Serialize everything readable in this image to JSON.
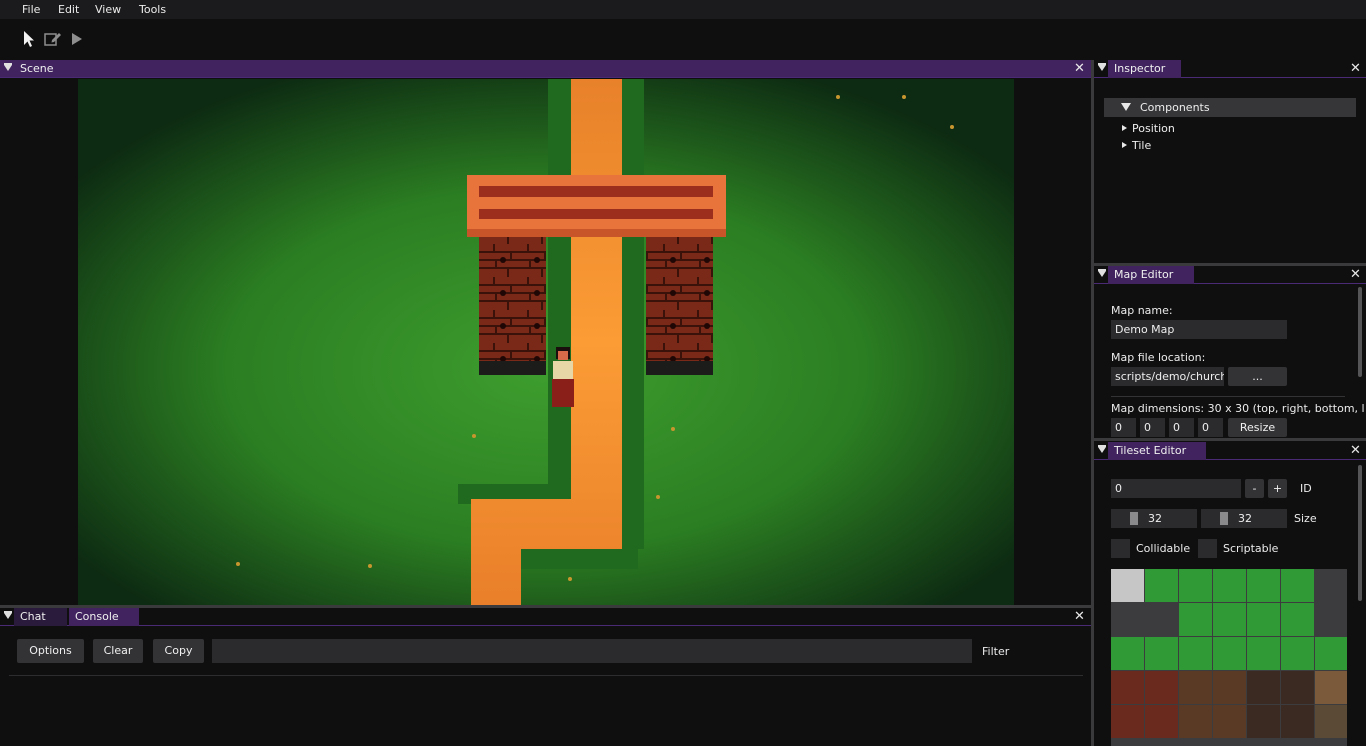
{
  "menu": {
    "file": "File",
    "edit": "Edit",
    "view": "View",
    "tools": "Tools"
  },
  "toolbar": {
    "select_icon": "cursor-icon",
    "edit_icon": "edit-icon",
    "play_icon": "play-icon"
  },
  "scene": {
    "tab": "Scene",
    "close": "✕"
  },
  "inspector": {
    "tab": "Inspector",
    "close": "✕",
    "components_label": "Components",
    "items": [
      "Position",
      "Tile"
    ]
  },
  "map_editor": {
    "tab": "Map Editor",
    "close": "✕",
    "name_label": "Map name:",
    "name_value": "Demo Map",
    "file_label": "Map file location:",
    "file_value": "scripts/demo/church",
    "browse_label": "...",
    "dims_label": "Map dimensions: 30 x 30 (top, right, bottom, l",
    "dims": [
      "0",
      "0",
      "0",
      "0"
    ],
    "resize_label": "Resize"
  },
  "tileset_editor": {
    "tab": "Tileset Editor",
    "close": "✕",
    "id_value": "0",
    "minus": "-",
    "plus": "+",
    "id_label": "ID",
    "width_value": "32",
    "height_value": "32",
    "size_label": "Size",
    "collidable_label": "Collidable",
    "scriptable_label": "Scriptable"
  },
  "bottom": {
    "tabs": [
      "Chat",
      "Console"
    ],
    "close": "✕",
    "options_label": "Options",
    "clear_label": "Clear",
    "copy_label": "Copy",
    "filter_value": "",
    "filter_label": "Filter"
  },
  "colors": {
    "accent": "#41235f",
    "grass": "#2f8a2a",
    "path": "#f3922e",
    "brick": "#8a2e1e"
  }
}
